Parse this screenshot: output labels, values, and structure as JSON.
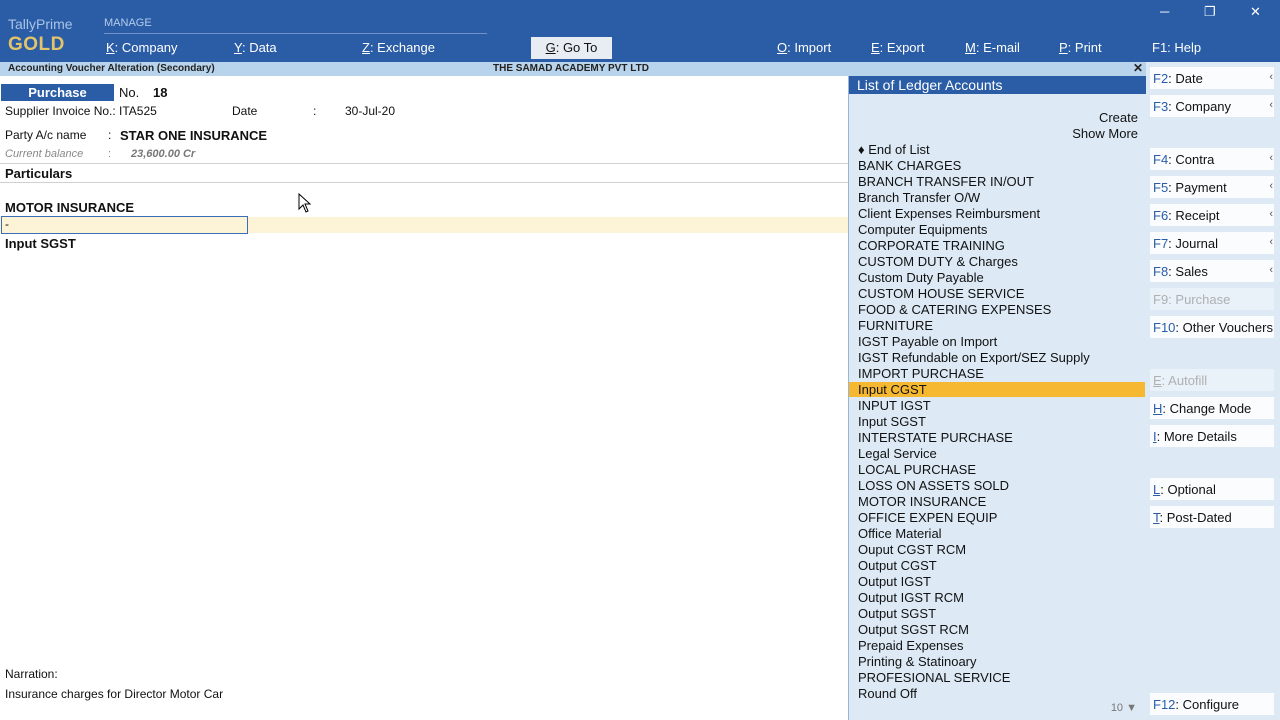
{
  "app": {
    "brand_top": "TallyPrime",
    "brand_bottom": "GOLD",
    "manage_label": "MANAGE"
  },
  "menu": {
    "company": {
      "key": "K",
      "label": ": Company"
    },
    "data": {
      "key": "Y",
      "label": ": Data"
    },
    "exchange": {
      "key": "Z",
      "label": ": Exchange"
    },
    "goto": {
      "key": "G",
      "label": ": Go To"
    },
    "import": {
      "key": "O",
      "label": ": Import"
    },
    "export": {
      "key": "E",
      "label": ": Export"
    },
    "email": {
      "key": "M",
      "label": ": E-mail"
    },
    "print": {
      "key": "P",
      "label": ": Print"
    },
    "help": {
      "key": "F1",
      "label": ": Help"
    }
  },
  "window": {
    "minimize": "─",
    "restore": "❐",
    "close": "✕"
  },
  "titlebar": {
    "left": "Accounting Voucher Alteration (Secondary)",
    "center": "THE SAMAD ACADEMY PVT LTD",
    "close": "✕"
  },
  "voucher": {
    "type": "Purchase",
    "no_label": "No.",
    "no_value": "18",
    "supplier_label": "Supplier Invoice No.:",
    "supplier_value": "ITA525",
    "date_label": "Date",
    "date_colon": ":",
    "date_value": "30-Jul-20",
    "party_label": "Party A/c name",
    "party_colon": ":",
    "party_value": "STAR ONE INSURANCE",
    "balance_label": "Current balance",
    "balance_colon": ":",
    "balance_value": "23,600.00 Cr",
    "particulars_label": "Particulars",
    "entries": [
      "MOTOR INSURANCE",
      "Input SGST"
    ],
    "input_value": "-",
    "narration_label": "Narration:",
    "narration_value": "Insurance charges for Director Motor Car"
  },
  "ledger_list": {
    "title": "List of Ledger Accounts",
    "create": "Create",
    "show_more": "Show More",
    "items": [
      "♦ End of List",
      "BANK CHARGES",
      "BRANCH TRANSFER IN/OUT",
      "Branch Transfer O/W",
      "Client Expenses Reimbursment",
      "Computer Equipments",
      "CORPORATE TRAINING",
      "CUSTOM DUTY & Charges",
      "Custom Duty Payable",
      "CUSTOM HOUSE SERVICE",
      "FOOD & CATERING EXPENSES",
      "FURNITURE",
      "IGST Payable on Import",
      "IGST Refundable on Export/SEZ Supply",
      "IMPORT PURCHASE",
      "Input CGST",
      "INPUT IGST",
      "Input SGST",
      "INTERSTATE PURCHASE",
      "Legal Service",
      "LOCAL PURCHASE",
      "LOSS ON ASSETS SOLD",
      "MOTOR INSURANCE",
      "OFFICE EXPEN EQUIP",
      "Office Material",
      "Ouput CGST RCM",
      "Output CGST",
      "Output IGST",
      "Output IGST RCM",
      "Output SGST",
      "Output SGST RCM",
      "Prepaid Expenses",
      "Printing & Statinoary",
      "PROFESIONAL SERVICE",
      "Round Off"
    ],
    "selected": "Input CGST",
    "more_count": "10 ▼"
  },
  "sidebar": {
    "f2": {
      "key": "F2",
      "label": ": Date"
    },
    "f3": {
      "key": "F3",
      "label": ": Company"
    },
    "f4": {
      "key": "F4",
      "label": ": Contra"
    },
    "f5": {
      "key": "F5",
      "label": ": Payment"
    },
    "f6": {
      "key": "F6",
      "label": ": Receipt"
    },
    "f7": {
      "key": "F7",
      "label": ": Journal"
    },
    "f8": {
      "key": "F8",
      "label": ": Sales"
    },
    "f9": {
      "key": "F9",
      "label": ": Purchase"
    },
    "f10": {
      "key": "F10",
      "label": ": Other Vouchers"
    },
    "autofill": {
      "key": "E",
      "label": ": Autofill"
    },
    "change_mode": {
      "key": "H",
      "label": ": Change Mode"
    },
    "more_details": {
      "key": "I",
      "label": ": More Details"
    },
    "optional": {
      "key": "L",
      "label": ": Optional"
    },
    "post_dated": {
      "key": "T",
      "label": ": Post-Dated"
    },
    "f12": {
      "key": "F12",
      "label": ": Configure"
    },
    "arrow": "‹"
  },
  "colors": {
    "header_blue": "#2a5da6",
    "panel_blue": "#ddeaf6",
    "highlight": "#f6b830",
    "current_line": "#fdf3d6"
  }
}
